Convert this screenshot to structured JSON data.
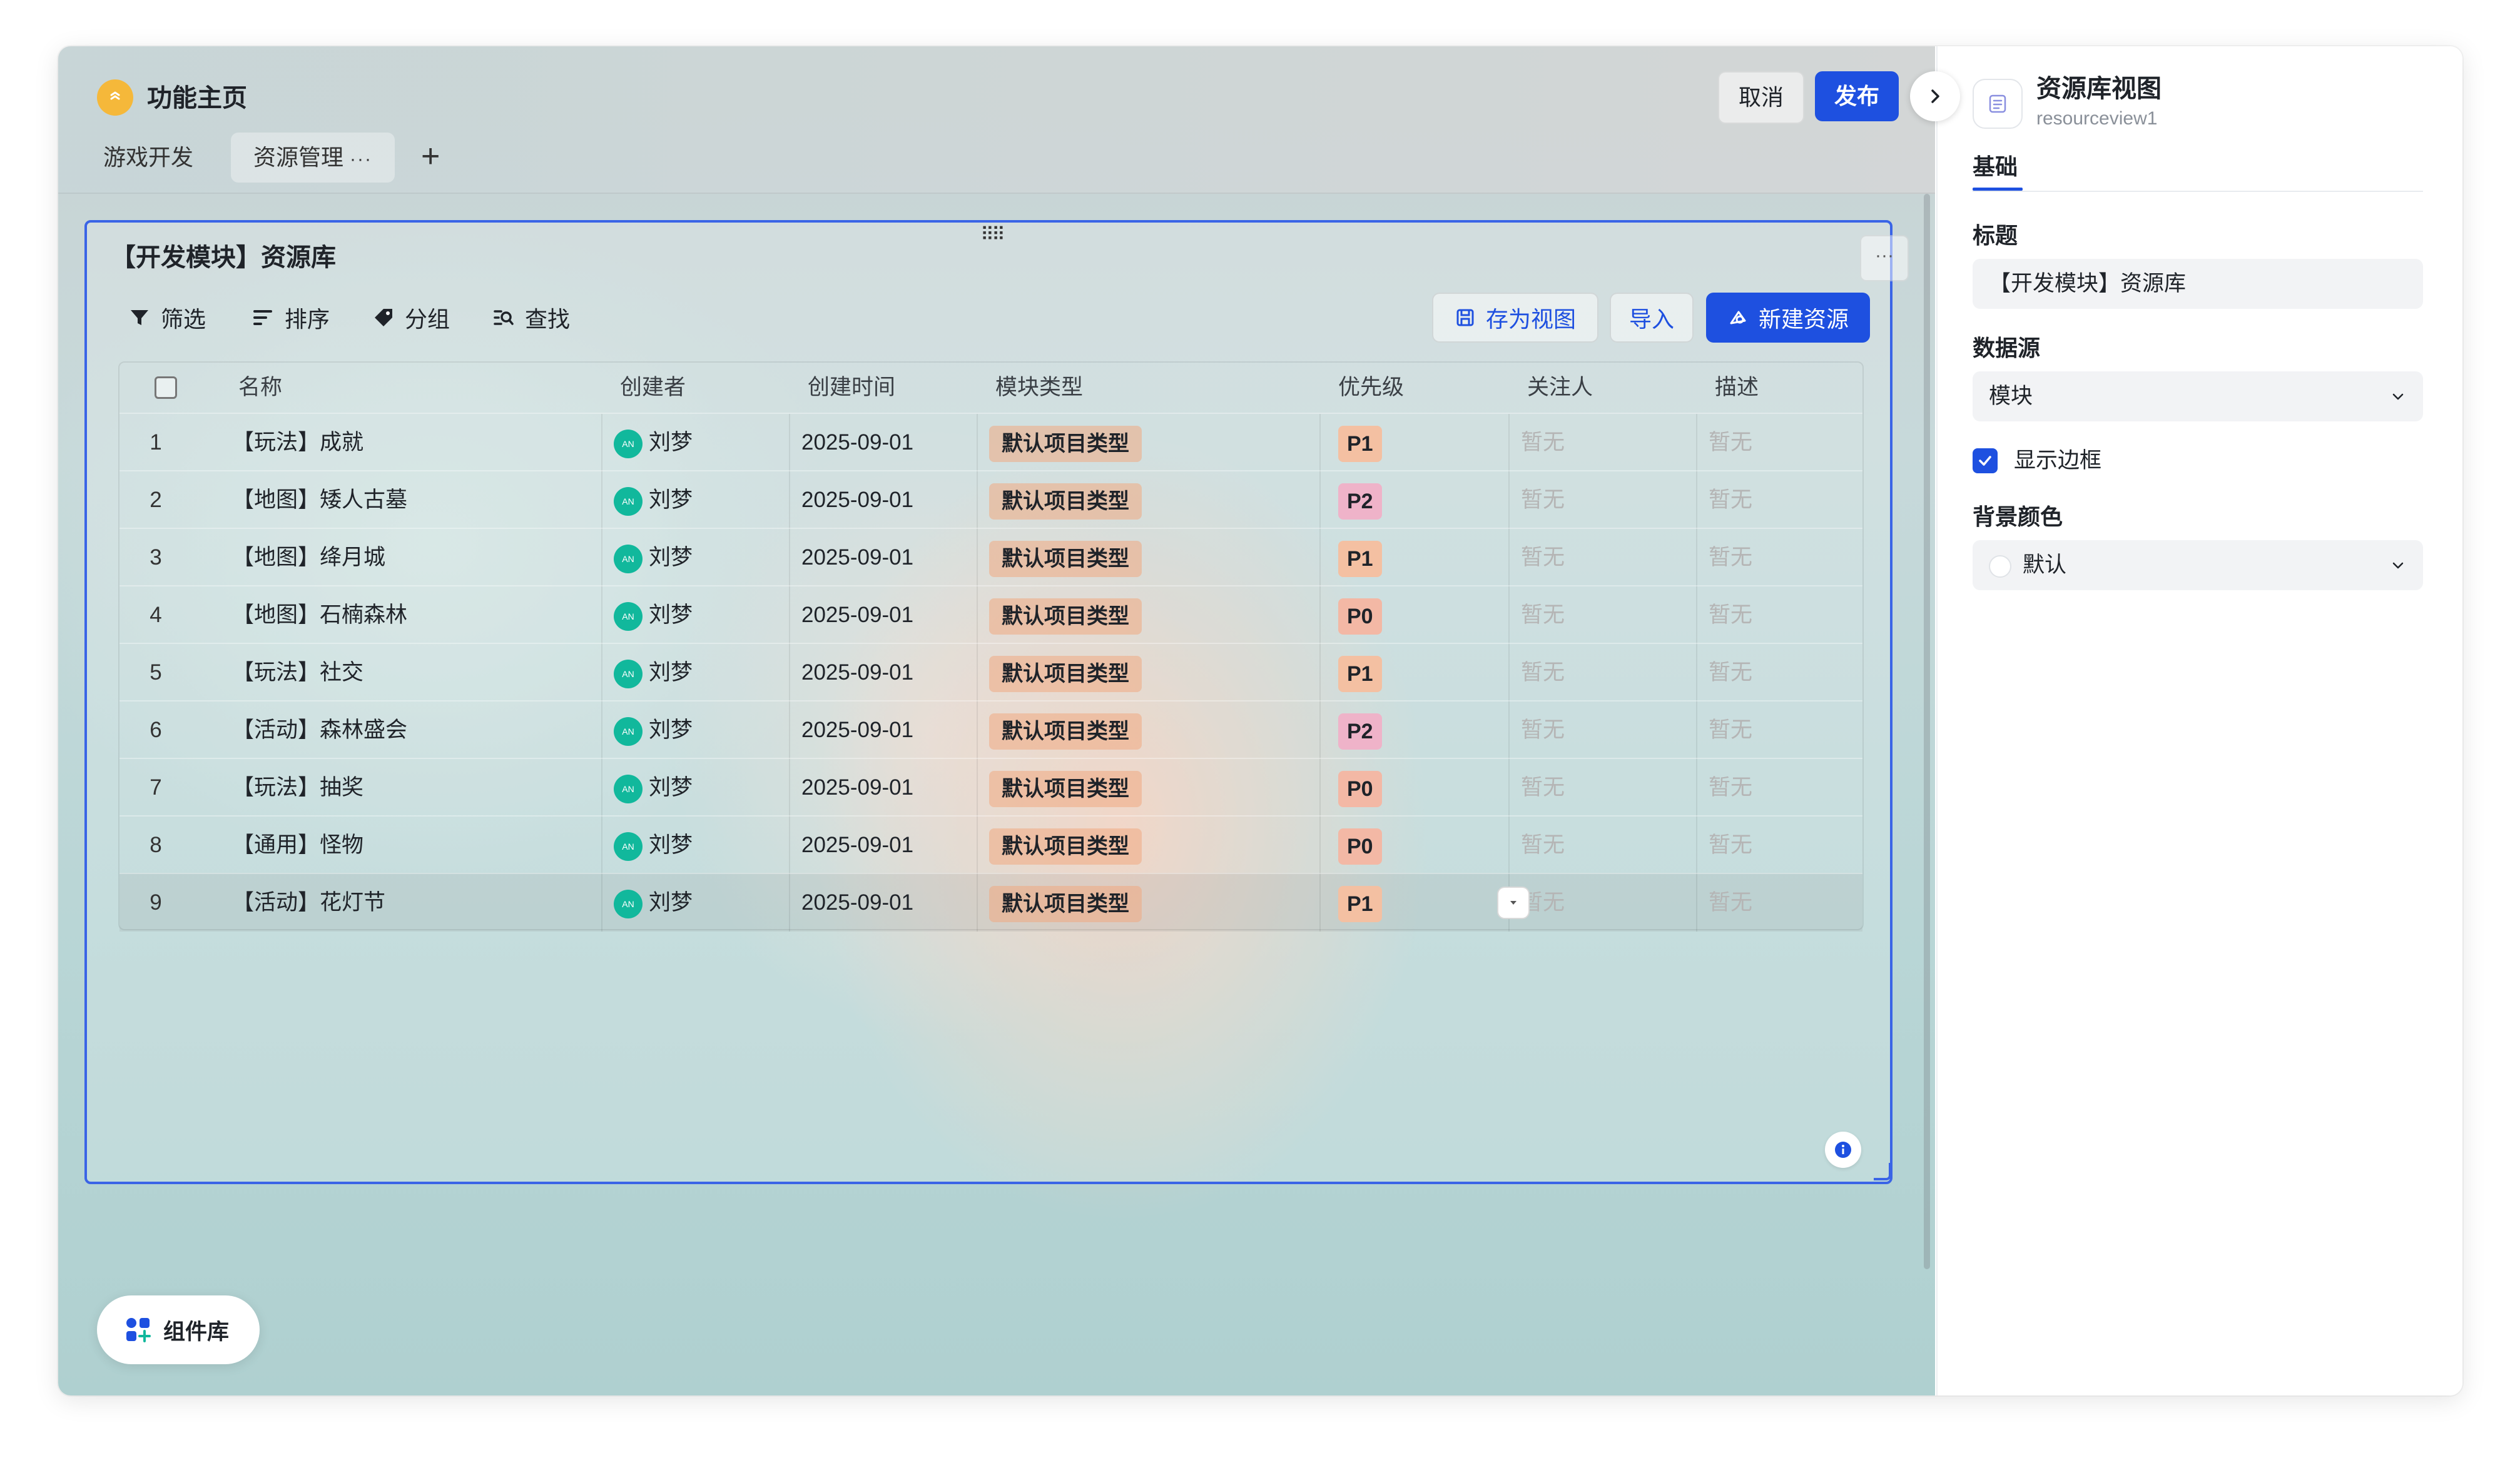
{
  "app": {
    "title": "功能主页"
  },
  "tabs": [
    {
      "label": "游戏开发"
    },
    {
      "label": "资源管理",
      "more": "···"
    }
  ],
  "topbar": {
    "cancel_label": "取消",
    "publish_label": "发布"
  },
  "view": {
    "title": "【开发模块】资源库",
    "toolbar": {
      "filter": "筛选",
      "sort": "排序",
      "group": "分组",
      "find": "查找",
      "save_view": "存为视图",
      "import": "导入",
      "new_resource": "新建资源"
    },
    "columns": [
      "名称",
      "创建者",
      "创建时间",
      "模块类型",
      "优先级",
      "关注人",
      "描述"
    ],
    "rows": [
      {
        "idx": "1",
        "name": "【玩法】成就",
        "creator": "刘梦",
        "created": "2025-09-01",
        "type": "默认项目类型",
        "priority": "P1",
        "watcher": "暂无",
        "desc": "暂无"
      },
      {
        "idx": "2",
        "name": "【地图】矮人古墓",
        "creator": "刘梦",
        "created": "2025-09-01",
        "type": "默认项目类型",
        "priority": "P2",
        "watcher": "暂无",
        "desc": "暂无"
      },
      {
        "idx": "3",
        "name": "【地图】绛月城",
        "creator": "刘梦",
        "created": "2025-09-01",
        "type": "默认项目类型",
        "priority": "P1",
        "watcher": "暂无",
        "desc": "暂无"
      },
      {
        "idx": "4",
        "name": "【地图】石楠森林",
        "creator": "刘梦",
        "created": "2025-09-01",
        "type": "默认项目类型",
        "priority": "P0",
        "watcher": "暂无",
        "desc": "暂无"
      },
      {
        "idx": "5",
        "name": "【玩法】社交",
        "creator": "刘梦",
        "created": "2025-09-01",
        "type": "默认项目类型",
        "priority": "P1",
        "watcher": "暂无",
        "desc": "暂无"
      },
      {
        "idx": "6",
        "name": "【活动】森林盛会",
        "creator": "刘梦",
        "created": "2025-09-01",
        "type": "默认项目类型",
        "priority": "P2",
        "watcher": "暂无",
        "desc": "暂无"
      },
      {
        "idx": "7",
        "name": "【玩法】抽奖",
        "creator": "刘梦",
        "created": "2025-09-01",
        "type": "默认项目类型",
        "priority": "P0",
        "watcher": "暂无",
        "desc": "暂无"
      },
      {
        "idx": "8",
        "name": "【通用】怪物",
        "creator": "刘梦",
        "created": "2025-09-01",
        "type": "默认项目类型",
        "priority": "P0",
        "watcher": "暂无",
        "desc": "暂无"
      },
      {
        "idx": "9",
        "name": "【活动】花灯节",
        "creator": "刘梦",
        "created": "2025-09-01",
        "type": "默认项目类型",
        "priority": "P1",
        "watcher": "暂无",
        "desc": "暂无"
      }
    ],
    "priority_colors": {
      "P0": "#f3b8a5",
      "P1": "#f4c0a2",
      "P2": "#efb3c9"
    }
  },
  "component_library": {
    "label": "组件库"
  },
  "panel": {
    "title": "资源库视图",
    "subtitle": "resourceview1",
    "tab": "基础",
    "title_label": "标题",
    "title_value": "【开发模块】资源库",
    "datasource_label": "数据源",
    "datasource_value": "模块",
    "show_border_label": "显示边框",
    "show_border_checked": true,
    "bg_color_label": "背景颜色",
    "bg_color_value": "默认"
  },
  "colors": {
    "accent": "#1e50e0",
    "selection_border": "#3a64e6",
    "avatar": "#11b89c"
  }
}
